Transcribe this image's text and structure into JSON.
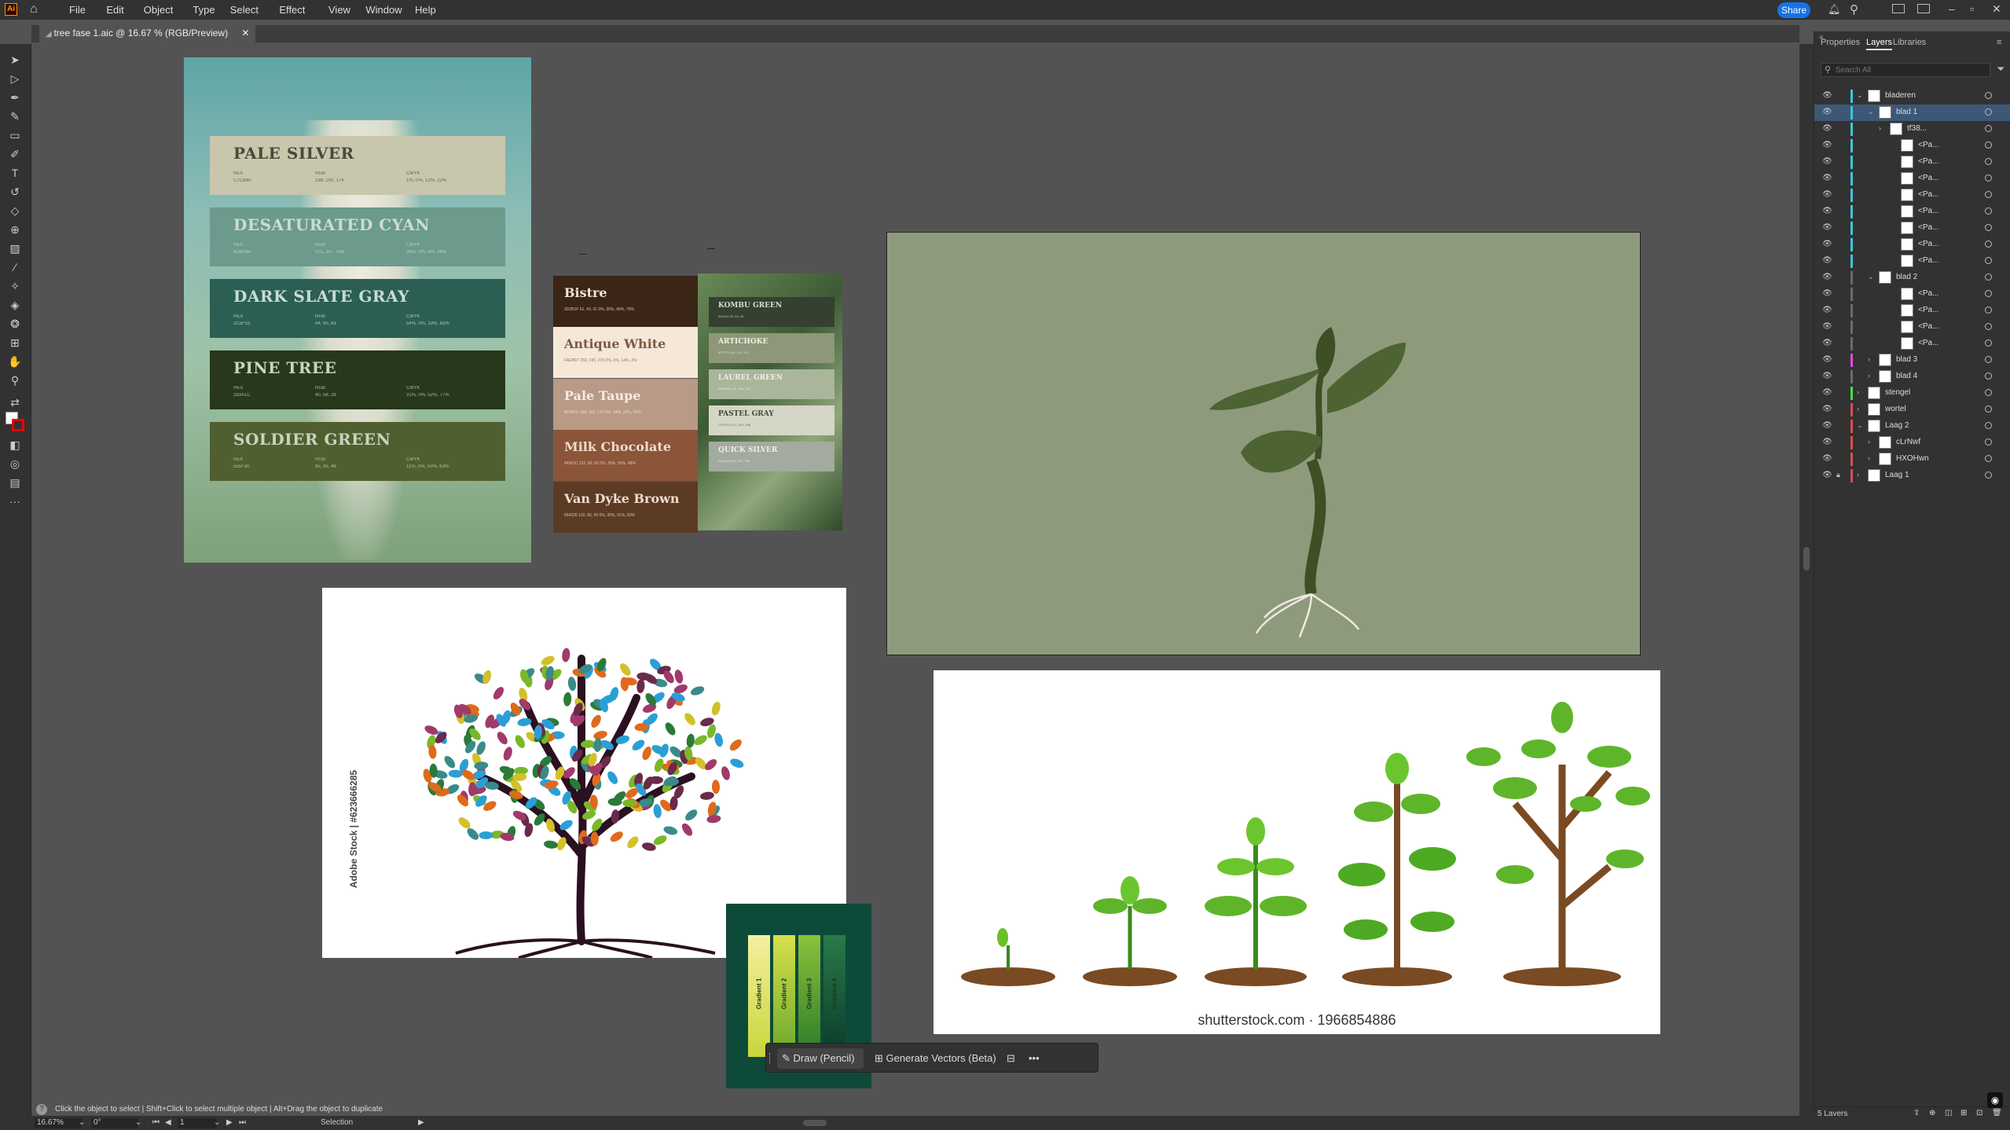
{
  "app": {
    "logo": "Ai"
  },
  "menu": [
    "File",
    "Edit",
    "Object",
    "Type",
    "Select",
    "Effect",
    "View",
    "Window",
    "Help"
  ],
  "header": {
    "share_label": "Share"
  },
  "document": {
    "tab_title": "tree fase 1.aic @ 16.67 % (RGB/Preview)"
  },
  "panel": {
    "tabs": [
      "Properties",
      "Layers",
      "Libraries"
    ],
    "search_placeholder": "Search All",
    "layers": [
      {
        "name": "bladeren",
        "indent": 0,
        "expanded": true,
        "color": "#3ec7d9",
        "thumb": true
      },
      {
        "name": "blad 1",
        "indent": 1,
        "expanded": true,
        "color": "#3ec7d9",
        "selected": true
      },
      {
        "name": "tf38...",
        "indent": 2,
        "expanded": false,
        "color": "#3ec7d9"
      },
      {
        "name": "<Pa...",
        "indent": 3,
        "color": "#3ec7d9"
      },
      {
        "name": "<Pa...",
        "indent": 3,
        "color": "#3ec7d9"
      },
      {
        "name": "<Pa...",
        "indent": 3,
        "color": "#3ec7d9"
      },
      {
        "name": "<Pa...",
        "indent": 3,
        "color": "#3ec7d9"
      },
      {
        "name": "<Pa...",
        "indent": 3,
        "color": "#3ec7d9"
      },
      {
        "name": "<Pa...",
        "indent": 3,
        "color": "#3ec7d9"
      },
      {
        "name": "<Pa...",
        "indent": 3,
        "color": "#3ec7d9"
      },
      {
        "name": "<Pa...",
        "indent": 3,
        "color": "#3ec7d9"
      },
      {
        "name": "blad 2",
        "indent": 1,
        "expanded": true,
        "color": "#6b6b6b"
      },
      {
        "name": "<Pa...",
        "indent": 3,
        "color": "#6b6b6b"
      },
      {
        "name": "<Pa...",
        "indent": 3,
        "color": "#6b6b6b"
      },
      {
        "name": "<Pa...",
        "indent": 3,
        "color": "#6b6b6b"
      },
      {
        "name": "<Pa...",
        "indent": 3,
        "color": "#6b6b6b"
      },
      {
        "name": "blad 3",
        "indent": 1,
        "expanded": false,
        "color": "#d94ed9"
      },
      {
        "name": "blad 4",
        "indent": 1,
        "expanded": false,
        "color": "#6b6b6b"
      },
      {
        "name": "stengel",
        "indent": 0,
        "expanded": false,
        "color": "#4ed94e"
      },
      {
        "name": "wortel",
        "indent": 0,
        "expanded": false,
        "color": "#d94e4e"
      },
      {
        "name": "Laag 2",
        "indent": 0,
        "expanded": true,
        "color": "#d94e4e"
      },
      {
        "name": "cLrNwf",
        "indent": 1,
        "expanded": false,
        "color": "#d94e4e"
      },
      {
        "name": "HXOHwn",
        "indent": 1,
        "expanded": false,
        "color": "#d94e4e"
      },
      {
        "name": "Laag 1",
        "indent": 0,
        "expanded": false,
        "color": "#d94e4e",
        "locked": true
      }
    ],
    "footer_count": "5 Layers"
  },
  "status": {
    "hint": "Click the object to select  |  Shift+Click to select multiple object  |  Alt+Drag the object to duplicate",
    "zoom": "16.67%",
    "rotation": "0°",
    "artboard": "1",
    "tool": "Selection"
  },
  "taskbar": {
    "draw_label": "Draw (Pencil)",
    "generate_label": "Generate Vectors (Beta)",
    "more": "•••"
  },
  "palette1": [
    {
      "name": "PALE SILVER",
      "bg": "#c8c7ad",
      "fg": "#4a4a3c",
      "hex": "C7C8B0",
      "rgb": "199, 200, 176",
      "cmyk": "1%, 0%, 12%, 22%"
    },
    {
      "name": "DESATURATED CYAN",
      "bg": "#6c9a8d",
      "fg": "#c9dcd4",
      "hex": "6D9D8A",
      "rgb": "101, 157, 148",
      "cmyk": "36%, 0%, 6%, 38%"
    },
    {
      "name": "DARK SLATE GRAY",
      "bg": "#2c5f53",
      "fg": "#c9dcd4",
      "hex": "2C5F53",
      "rgb": "44, 95, 83",
      "cmyk": "54%, 0%, 13%, 63%"
    },
    {
      "name": "PINE TREE",
      "bg": "#28381c",
      "fg": "#c9d4be",
      "hex": "283A1C",
      "rgb": "40, 58, 28",
      "cmyk": "31%, 0%, 52%, 77%"
    },
    {
      "name": "SOLDIER GREEN",
      "bg": "#505f30",
      "fg": "#c9d4be",
      "hex": "555F30",
      "rgb": "85, 95, 48",
      "cmyk": "11%, 0%, 50%, 63%"
    }
  ],
  "palette2": [
    {
      "name": "Bistre",
      "bg": "#3b2517",
      "fg": "#f1e4d8",
      "meta": "3D2B1F   61, 43, 31   0%, 30%, 49%, 76%"
    },
    {
      "name": "Antique White",
      "bg": "#f5e8d9",
      "fg": "#7a5a45",
      "meta": "FAEBD7   250, 235, 215   0%, 6%, 14%, 2%"
    },
    {
      "name": "Pale Taupe",
      "bg": "#b89a86",
      "fg": "#f5ece4",
      "meta": "BC987E   188, 152, 126   0%, 19%, 33%, 26%"
    },
    {
      "name": "Milk Chocolate",
      "bg": "#8a5538",
      "fg": "#f0dccd",
      "meta": "84563C   132, 86, 60   0%, 35%, 55%, 48%"
    },
    {
      "name": "Van Dyke Brown",
      "bg": "#5c3b24",
      "fg": "#f0dccd",
      "meta": "664228   102, 66, 40   0%, 35%, 61%, 60%"
    }
  ],
  "palette3": [
    {
      "name": "KOMBU GREEN",
      "bg": "#354031",
      "fg": "#d7dccf",
      "meta": "354230   53, 66, 48"
    },
    {
      "name": "ARTICHOKE",
      "bg": "#8e9779",
      "fg": "#f0f0e6",
      "meta": "8F9779   143, 151, 121"
    },
    {
      "name": "LAUREL GREEN",
      "bg": "#a9b69b",
      "fg": "#f0f0e6",
      "meta": "A9BA9D   169, 186, 157"
    },
    {
      "name": "PASTEL GRAY",
      "bg": "#d6d6c6",
      "fg": "#4a4a3c",
      "meta": "CFCFC4   207, 207, 196"
    },
    {
      "name": "QUICK SILVER",
      "bg": "#a3aa9f",
      "fg": "#f0f0e6",
      "meta": "A6A6A6   166, 166, 166"
    }
  ],
  "gradients": [
    "Gradient 1",
    "Gradient 2",
    "Gradient 3",
    "Gradient 4"
  ],
  "watermarks": {
    "adobe": "Adobe Stock | #623666285",
    "shutter": "shutterstock.com · 1966854886"
  }
}
